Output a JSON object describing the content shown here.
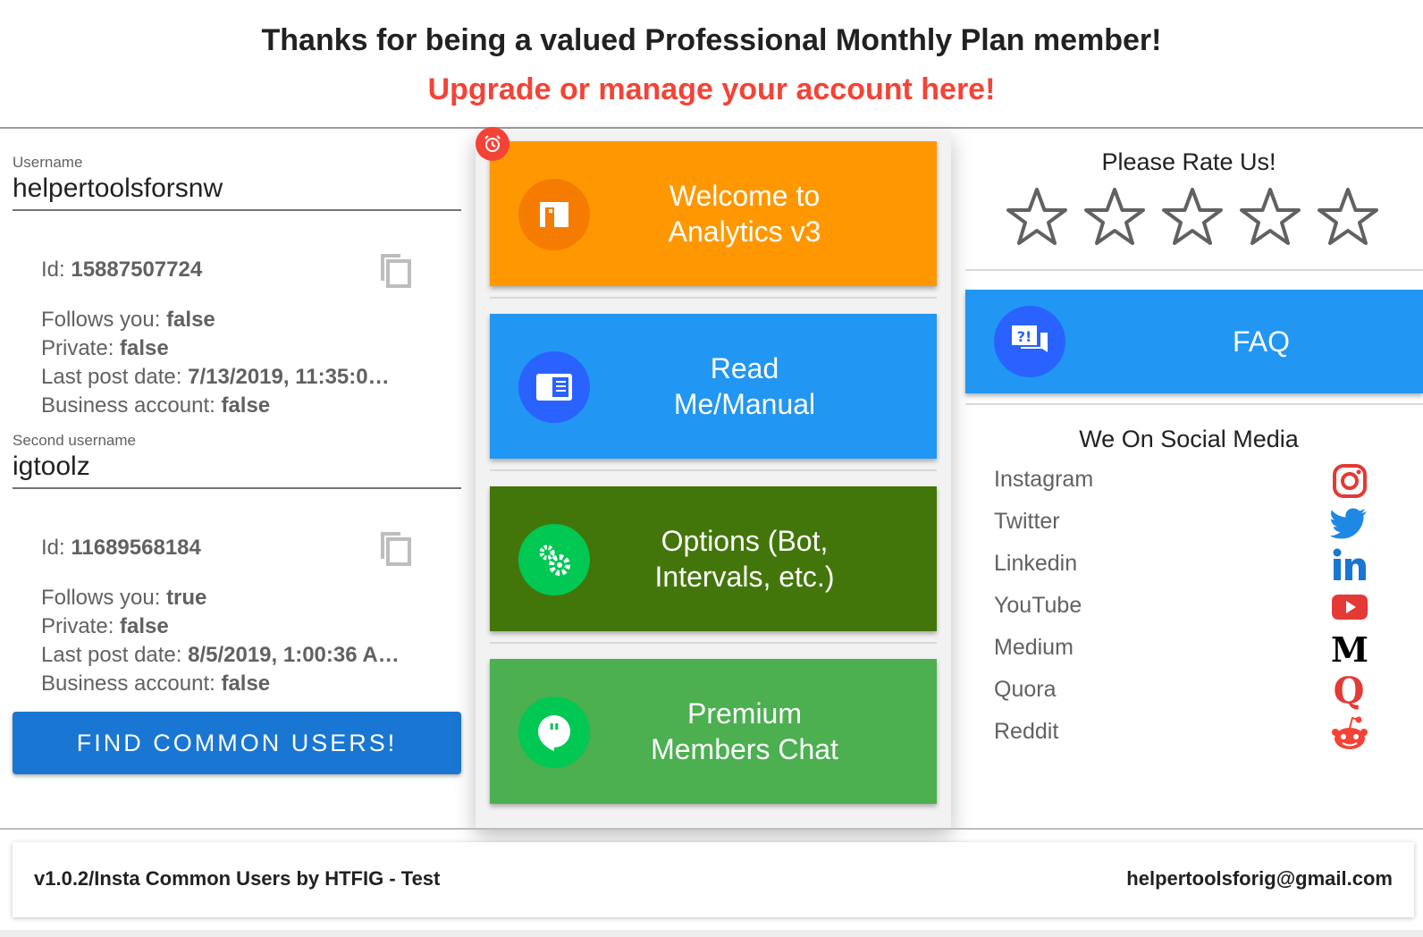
{
  "header": {
    "title": "Thanks for being a valued Professional Monthly Plan member!",
    "link": "Upgrade or manage your account here!"
  },
  "users": [
    {
      "field_label": "Username",
      "value": "helpertoolsforsnw",
      "id_label": "Id: ",
      "id": "15887507724",
      "follows_label": "Follows you: ",
      "follows": "false",
      "private_label": "Private: ",
      "private": "false",
      "last_post_label": "Last post date: ",
      "last_post": "7/13/2019, 11:35:0…",
      "business_label": "Business account: ",
      "business": "false"
    },
    {
      "field_label": "Second username",
      "value": "igtoolz",
      "id_label": "Id: ",
      "id": "11689568184",
      "follows_label": "Follows you: ",
      "follows": "true",
      "private_label": "Private: ",
      "private": "false",
      "last_post_label": "Last post date: ",
      "last_post": "8/5/2019, 1:00:36 A…",
      "business_label": "Business account: ",
      "business": "false"
    }
  ],
  "find_button": "FIND COMMON USERS!",
  "tiles": [
    {
      "line1": "Welcome to",
      "line2": "Analytics v3",
      "color": "#ff9800",
      "circle": "#f57c00",
      "icon": "door-icon"
    },
    {
      "line1": "Read",
      "line2": "Me/Manual",
      "color": "#2196f3",
      "circle": "#2962ff",
      "icon": "manual-icon"
    },
    {
      "line1": "Options (Bot,",
      "line2": "Intervals, etc.)",
      "color": "#43760a",
      "circle": "#00c853",
      "icon": "gears-icon"
    },
    {
      "line1": "Premium",
      "line2": "Members Chat",
      "color": "#4caf50",
      "circle": "#00c853",
      "icon": "chat-icon"
    }
  ],
  "rating": {
    "title": "Please Rate Us!",
    "stars": 5,
    "filled": 0
  },
  "faq": {
    "label": "FAQ",
    "color": "#2196f3",
    "circle": "#2962ff"
  },
  "social": {
    "title": "We On Social Media",
    "items": [
      {
        "name": "Instagram",
        "icon": "instagram-icon"
      },
      {
        "name": "Twitter",
        "icon": "twitter-icon"
      },
      {
        "name": "Linkedin",
        "icon": "linkedin-icon"
      },
      {
        "name": "YouTube",
        "icon": "youtube-icon"
      },
      {
        "name": "Medium",
        "icon": "medium-icon"
      },
      {
        "name": "Quora",
        "icon": "quora-icon"
      },
      {
        "name": "Reddit",
        "icon": "reddit-icon"
      }
    ]
  },
  "footer": {
    "left": "v1.0.2/Insta Common Users by HTFIG - Test",
    "right": "helpertoolsforig@gmail.com"
  }
}
